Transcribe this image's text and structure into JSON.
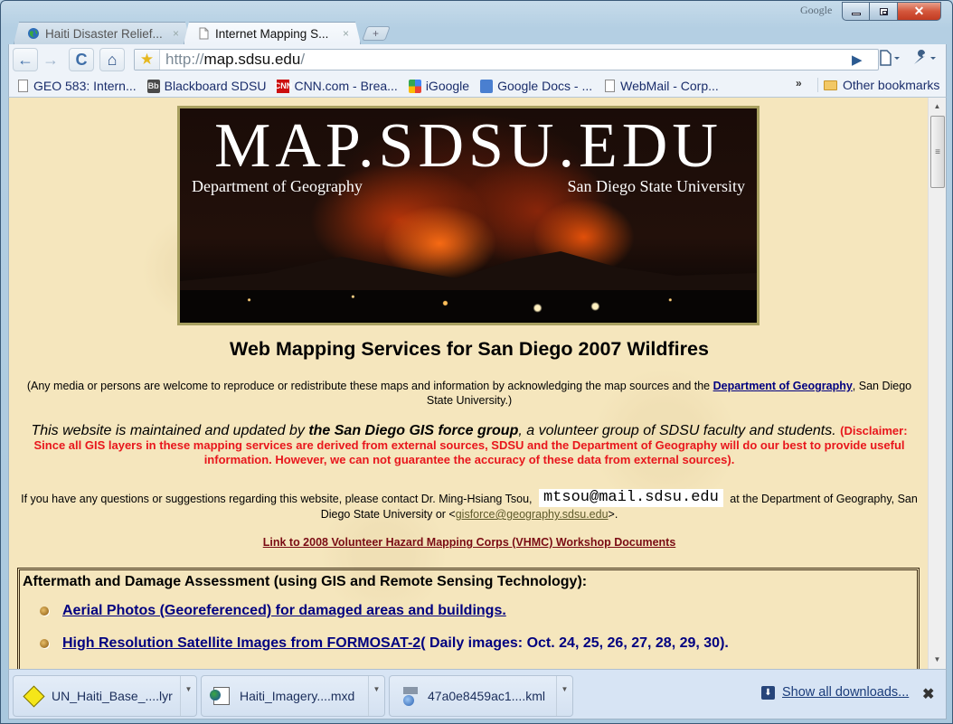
{
  "window": {
    "brand": "Google",
    "controls": {
      "minimize": "minimize",
      "maximize": "maximize",
      "close": "✕"
    }
  },
  "tabs": [
    {
      "title": "Haiti Disaster Relief...",
      "icon": "globe-icon",
      "active": false,
      "close": "×"
    },
    {
      "title": "Internet Mapping S...",
      "icon": "page-icon",
      "active": true,
      "close": "×"
    }
  ],
  "new_tab": "+",
  "toolbar": {
    "back": "←",
    "forward": "→",
    "reload": "C",
    "home": "⌂",
    "star": "★",
    "url_scheme": "http://",
    "url_host": "map.sdsu.edu",
    "url_path": "/",
    "go": "▶",
    "page_menu": "🗋▾",
    "wrench_menu": "🔧▾"
  },
  "bookmarks": {
    "items": [
      {
        "label": "GEO 583:  Intern...",
        "icon": "page-icon"
      },
      {
        "label": "Blackboard SDSU",
        "icon": "blackboard-icon"
      },
      {
        "label": "CNN.com - Brea...",
        "icon": "cnn-icon"
      },
      {
        "label": "iGoogle",
        "icon": "igoogle-icon"
      },
      {
        "label": "Google Docs - ...",
        "icon": "google-docs-icon"
      },
      {
        "label": "WebMail - Corp...",
        "icon": "page-icon"
      }
    ],
    "overflow": "»",
    "other": "Other bookmarks"
  },
  "banner": {
    "title": "MAP.SDSU.EDU",
    "left": "Department of Geography",
    "right": "San Diego State University"
  },
  "page": {
    "heading": "Web Mapping Services for San Diego 2007 Wildfires",
    "notice_pre": "(Any media or persons are welcome to reproduce or redistribute these maps and information by acknowledging the map sources and the ",
    "notice_link": "Department of Geography",
    "notice_post": ", San Diego State University.)",
    "maint_pre": "This website is maintained and updated by ",
    "maint_bold": "the San Diego GIS force group",
    "maint_post": ", a volunteer group of SDSU faculty and students. ",
    "disclaimer": "(Disclaimer: Since all GIS layers in these mapping services are derived from external sources, SDSU and the Department of Geography will do our best to provide useful information. However, we can not guarantee the accuracy of these data from external sources).",
    "contact_pre": "If you have any questions or suggestions regarding this website, please contact Dr. Ming-Hsiang Tsou, ",
    "contact_email": "mtsou@mail.sdsu.edu",
    "contact_mid": " at the Department of Geography, San Diego State University or <",
    "contact_link": "gisforce@geography.sdsu.edu",
    "contact_post": ">.",
    "vhmc_link": "Link to 2008 Volunteer Hazard Mapping Corps (VHMC) Workshop Documents"
  },
  "section": {
    "title": "Aftermath and Damage Assessment (using GIS and Remote Sensing Technology):",
    "items": [
      {
        "link": "Aerial Photos (Georeferenced) for damaged areas and buildings.",
        "suffix": ""
      },
      {
        "link": "High Resolution Satellite Images from FORMOSAT-2 ",
        "suffix": "( Daily images: Oct. 24, 25, 26, 27, 28, 29, 30)."
      }
    ]
  },
  "downloads": {
    "items": [
      {
        "name": "UN_Haiti_Base_....lyr",
        "icon": "layer-file-icon"
      },
      {
        "name": "Haiti_Imagery....mxd",
        "icon": "map-document-icon"
      },
      {
        "name": "47a0e8459ac1....kml",
        "icon": "kml-file-icon"
      }
    ],
    "show_all": "Show all downloads...",
    "close": "✖"
  },
  "scrollbar": {
    "up": "▲",
    "down": "▼",
    "grip": "≡"
  }
}
